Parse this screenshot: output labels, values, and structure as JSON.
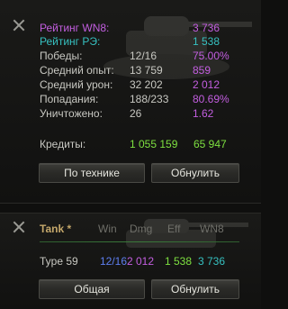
{
  "stats": {
    "wn8": {
      "label": "Рейтинг WN8:",
      "value": "3 736"
    },
    "re": {
      "label": "Рейтинг РЭ:",
      "value": "1 538"
    },
    "wins": {
      "label": "Победы:",
      "value": "12/16",
      "extra": "75.00%"
    },
    "avg_exp": {
      "label": "Средний опыт:",
      "value": "13 759",
      "extra": "859"
    },
    "avg_dmg": {
      "label": "Средний урон:",
      "value": "32 202",
      "extra": "2 012"
    },
    "hits": {
      "label": "Попадания:",
      "value": "188/233",
      "extra": "80.69%"
    },
    "kills": {
      "label": "Уничтожено:",
      "value": "26",
      "extra": "1.62"
    },
    "credits": {
      "label": "Кредиты:",
      "value": "1 055 159",
      "extra": "65 947"
    }
  },
  "buttons": {
    "by_vehicle": "По технике",
    "reset": "Обнулить",
    "general": "Общая"
  },
  "table": {
    "headers": {
      "tank": "Tank *",
      "win": "Win",
      "dmg": "Dmg",
      "eff": "Eff",
      "wn8": "WN8"
    },
    "rows": [
      {
        "tank": "Type 59",
        "win": "12/16",
        "dmg": "2 012",
        "eff": "1 538",
        "wn8": "3 736"
      }
    ]
  },
  "colors": {
    "purple": "#c35ee0",
    "teal": "#36c0c0",
    "green": "#7ee040",
    "yellow": "#d8cf4a",
    "blue": "#5e7ff0",
    "gold": "#c4a76a"
  },
  "icons": {
    "close": "close-icon",
    "tank_silhouette": "tank-silhouette-icon"
  }
}
